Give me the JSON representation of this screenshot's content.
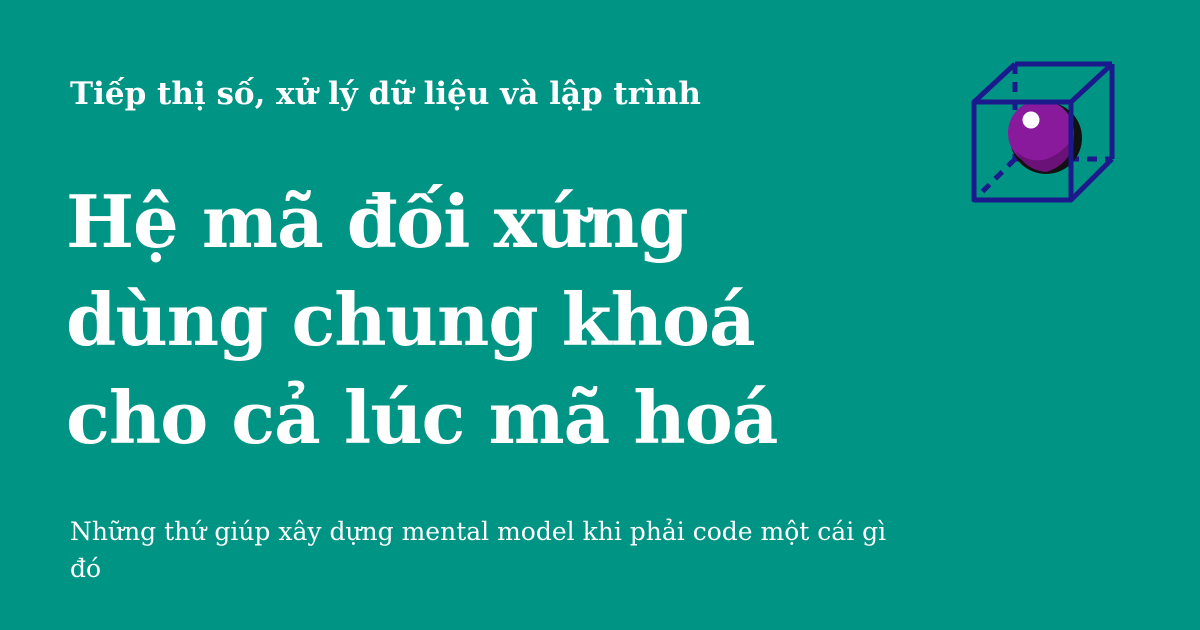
{
  "header": {
    "kicker": "Tiếp thị số, xử lý dữ liệu và lập trình"
  },
  "headline": {
    "lines": [
      "Hệ mã đối xứng",
      "dùng chung khoá",
      "cho cả lúc mã hoá"
    ]
  },
  "subtitle": "Những thứ giúp xây dựng mental model khi phải code một cái gì đó",
  "logo": {
    "icon": "cube-with-sphere-icon",
    "colors": {
      "background": "#009485",
      "cube": "#1a1a8c",
      "sphere": "#8a1a9c",
      "sphere_shadow": "#1a1a1a",
      "highlight": "#ffffff"
    }
  }
}
